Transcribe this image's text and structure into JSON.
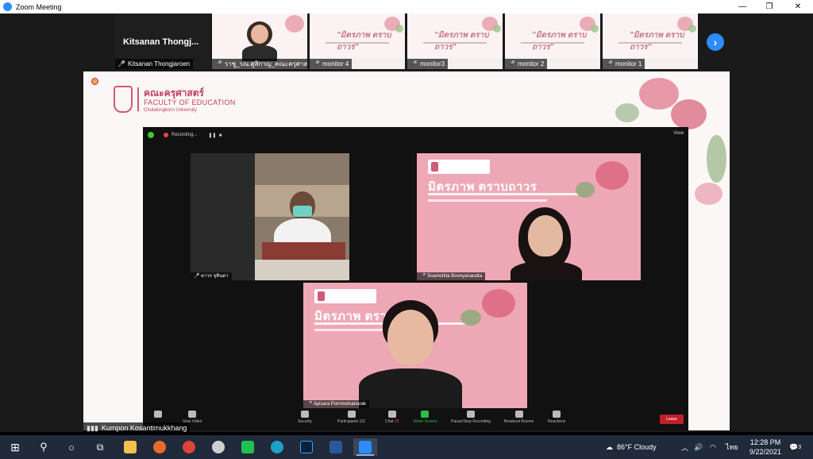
{
  "window": {
    "title": "Zoom Meeting",
    "controls": {
      "minimize": "—",
      "restore": "❐",
      "close": "✕"
    }
  },
  "gallery_strip": {
    "active_speaker_display": "Kitsanan  Thongj...",
    "active_speaker_label": "Kitsanan Thongjaroen",
    "tiles": [
      {
        "label": "ราชู_รณ.ศูสิกาญ_คณะครุศาสต..."
      },
      {
        "label": "monitor 4",
        "slide_title": "\"มิตรภาพ ตราบถาวร\""
      },
      {
        "label": "monitor3",
        "slide_title": "\"มิตรภาพ ตราบถาวร\""
      },
      {
        "label": "monitor 2",
        "slide_title": "\"มิตรภาพ ตราบถาวร\""
      },
      {
        "label": "monitor 1",
        "slide_title": "\"มิตรภาพ ตราบถาวร\""
      }
    ]
  },
  "shared_screen": {
    "logo_thai": "คณะครุศาสตร์",
    "logo_english": "FACULTY OF EDUCATION",
    "logo_university": "Chulalongkorn University",
    "inner_meeting": {
      "recording_text": "Recording...",
      "view_label": "View",
      "participants": [
        {
          "label": "ดาวร จุทินดา"
        },
        {
          "label": "Soamchita Boonyanaratta",
          "slide_title": "มิตรภาพ ตราบถาวร"
        },
        {
          "label": "Apisara Pornmetsanarak",
          "slide_title": "มิตรภาพ ตราบถาวร"
        }
      ],
      "toolbar": {
        "security": "Security",
        "participants": "Participants",
        "participants_count": "111",
        "chat": "Chat",
        "chat_badge": "39",
        "share": "Share Screen",
        "pause_recording": "Pause/Stop Recording",
        "breakout": "Breakout Rooms",
        "reactions": "Reactions",
        "leave": "Leave",
        "stop_video": "Stop Video"
      }
    }
  },
  "self_view": {
    "name": "Kumpon Kosantimukkhang"
  },
  "taskbar": {
    "weather": "86°F  Cloudy",
    "lang": "ไทย",
    "time": "12:28 PM",
    "date": "9/22/2021",
    "notification_count": "3"
  },
  "colors": {
    "zoom_blue": "#2d8cff",
    "accent_pink": "#c43d62",
    "slide_pink": "#eea8b5",
    "leave_red": "#c21f2a",
    "taskbar_bg": "#202a3a"
  }
}
